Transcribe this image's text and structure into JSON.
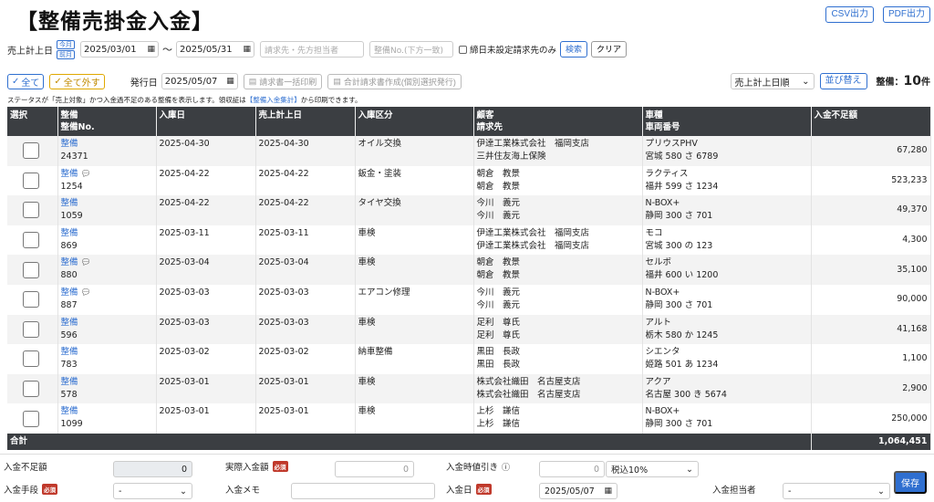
{
  "page": {
    "title": "【整備売掛金入金】",
    "csv_label": "CSV出力",
    "pdf_label": "PDF出力"
  },
  "filter": {
    "date_label": "売上計上日",
    "badge_month": "今月",
    "badge_prev": "前月",
    "date_from": "2025/03/01",
    "tilde": "〜",
    "date_to": "2025/05/31",
    "customer_placeholder": "請求先・先方担当者",
    "seibi_no_placeholder": "整備No.(下方一致)",
    "unset_label": "締日未設定請求先のみ",
    "search_label": "検索",
    "clear_label": "クリア"
  },
  "actions": {
    "all_label": "全て",
    "none_label": "全て外す",
    "issue_date_label": "発行日",
    "issue_date": "2025/05/07",
    "bulk_print_label": "請求書一括印刷",
    "combined_label": "合計請求書作成(個別選択発行)",
    "sort_value": "売上計上日順",
    "sort_button": "並び替え",
    "count_prefix": "整備：",
    "count_value": "10",
    "count_suffix": "件"
  },
  "note": {
    "before": "ステータスが「売上対象」かつ入金過不足のある整備を表示します。領収証は",
    "link": "【整備入金集計】",
    "after": "から印刷できます。"
  },
  "table": {
    "headers": {
      "select": "選択",
      "seibi": "整備",
      "seibi_no": "整備No.",
      "nyuko": "入庫日",
      "uriage": "売上計上日",
      "kubun": "入庫区分",
      "kokyaku": "顧客",
      "seikyu": "請求先",
      "shashu": "車種",
      "bango": "車両番号",
      "fusoku": "入金不足額"
    },
    "rows": [
      {
        "seibi": "整備",
        "no": "24371",
        "memo": false,
        "nyuko": "2025-04-30",
        "uriage": "2025-04-30",
        "kubun": "オイル交換",
        "kokyaku": "伊達工業株式会社　福岡支店",
        "seikyu": "三井住友海上保険",
        "shashu": "プリウスPHV",
        "bango": "宮城 580 さ 6789",
        "fusoku": "67,280"
      },
      {
        "seibi": "整備",
        "no": "1254",
        "memo": true,
        "nyuko": "2025-04-22",
        "uriage": "2025-04-22",
        "kubun": "鈑金・塗装",
        "kokyaku": "朝倉　教景",
        "seikyu": "朝倉　教景",
        "shashu": "ラクティス",
        "bango": "福井 599 さ 1234",
        "fusoku": "523,233"
      },
      {
        "seibi": "整備",
        "no": "1059",
        "memo": false,
        "nyuko": "2025-04-22",
        "uriage": "2025-04-22",
        "kubun": "タイヤ交換",
        "kokyaku": "今川　義元",
        "seikyu": "今川　義元",
        "shashu": "N-BOX+",
        "bango": "静岡 300 さ 701",
        "fusoku": "49,370"
      },
      {
        "seibi": "整備",
        "no": "869",
        "memo": false,
        "nyuko": "2025-03-11",
        "uriage": "2025-03-11",
        "kubun": "車検",
        "kokyaku": "伊達工業株式会社　福岡支店",
        "seikyu": "伊達工業株式会社　福岡支店",
        "shashu": "モコ",
        "bango": "宮城 300 の 123",
        "fusoku": "4,300"
      },
      {
        "seibi": "整備",
        "no": "880",
        "memo": true,
        "nyuko": "2025-03-04",
        "uriage": "2025-03-04",
        "kubun": "車検",
        "kokyaku": "朝倉　教景",
        "seikyu": "朝倉　教景",
        "shashu": "セルボ",
        "bango": "福井 600 い 1200",
        "fusoku": "35,100"
      },
      {
        "seibi": "整備",
        "no": "887",
        "memo": true,
        "nyuko": "2025-03-03",
        "uriage": "2025-03-03",
        "kubun": "エアコン修理",
        "kokyaku": "今川　義元",
        "seikyu": "今川　義元",
        "shashu": "N-BOX+",
        "bango": "静岡 300 さ 701",
        "fusoku": "90,000"
      },
      {
        "seibi": "整備",
        "no": "596",
        "memo": false,
        "nyuko": "2025-03-03",
        "uriage": "2025-03-03",
        "kubun": "車検",
        "kokyaku": "足利　尊氏",
        "seikyu": "足利　尊氏",
        "shashu": "アルト",
        "bango": "栃木 580 か 1245",
        "fusoku": "41,168"
      },
      {
        "seibi": "整備",
        "no": "783",
        "memo": false,
        "nyuko": "2025-03-02",
        "uriage": "2025-03-02",
        "kubun": "納車整備",
        "kokyaku": "黒田　長政",
        "seikyu": "黒田　長政",
        "shashu": "シエンタ",
        "bango": "姫路 501 あ 1234",
        "fusoku": "1,100"
      },
      {
        "seibi": "整備",
        "no": "578",
        "memo": false,
        "nyuko": "2025-03-01",
        "uriage": "2025-03-01",
        "kubun": "車検",
        "kokyaku": "株式会社織田　名古屋支店",
        "seikyu": "株式会社織田　名古屋支店",
        "shashu": "アクア",
        "bango": "名古屋 300 き 5674",
        "fusoku": "2,900"
      },
      {
        "seibi": "整備",
        "no": "1099",
        "memo": false,
        "nyuko": "2025-03-01",
        "uriage": "2025-03-01",
        "kubun": "車検",
        "kokyaku": "上杉　謙信",
        "seikyu": "上杉　謙信",
        "shashu": "N-BOX+",
        "bango": "静岡 300 さ 701",
        "fusoku": "250,000"
      }
    ],
    "total_label": "合計",
    "total_value": "1,064,451"
  },
  "payment": {
    "shortage_label": "入金不足額",
    "shortage_value": "0",
    "actual_label": "実際入金額",
    "actual_placeholder": "0",
    "discount_label": "入金時値引き",
    "discount_placeholder": "0",
    "tax_value": "税込10%",
    "method_label": "入金手段",
    "method_value": "-",
    "memo_label": "入金メモ",
    "date_label": "入金日",
    "date_value": "2025/05/07",
    "staff_label": "入金担当者",
    "staff_value": "-",
    "required": "必須",
    "save_label": "保存"
  }
}
